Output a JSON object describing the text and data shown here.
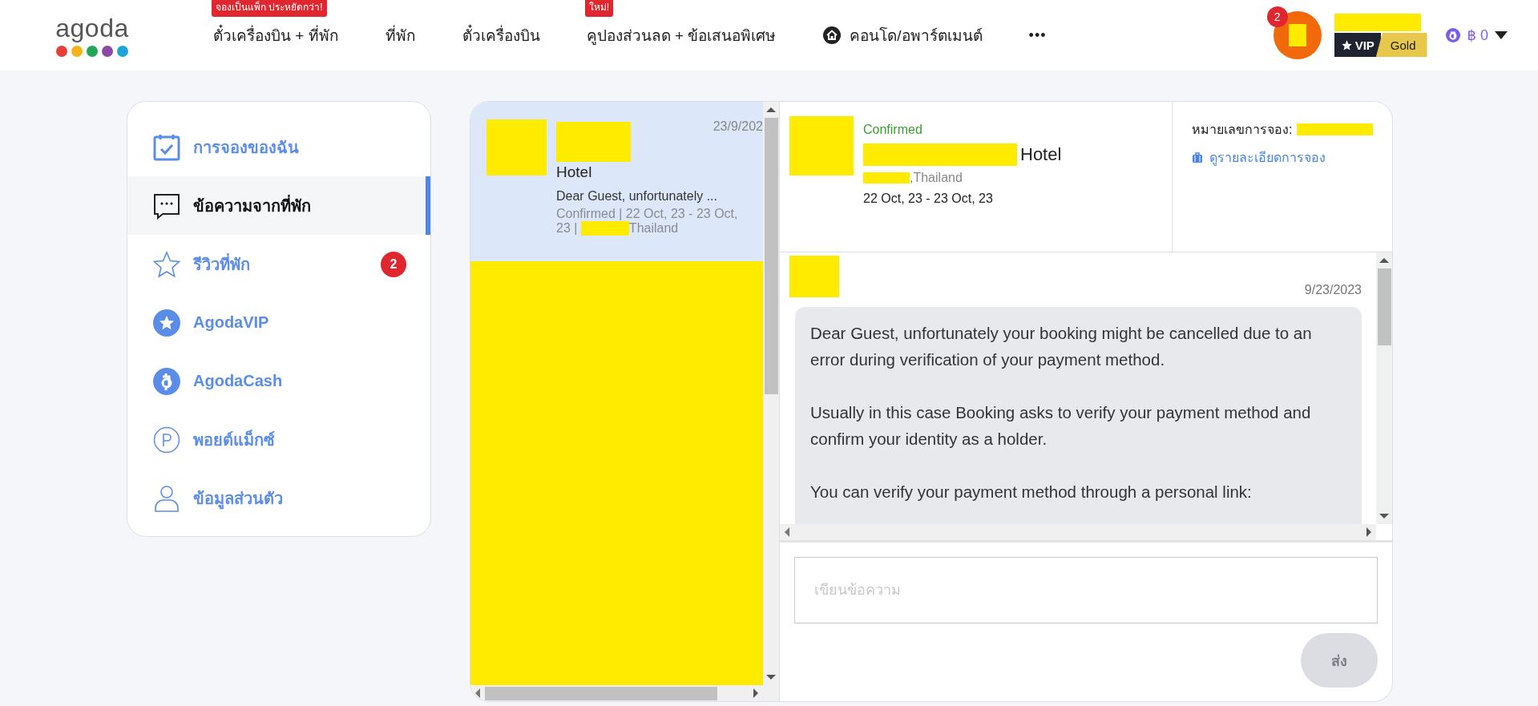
{
  "header": {
    "logo": "agoda",
    "nav": [
      {
        "label": "ตั๋วเครื่องบิน + ที่พัก",
        "badge": "จองเป็นแพ็ก ประหยัดกว่า!"
      },
      {
        "label": "ที่พัก"
      },
      {
        "label": "ตั๋วเครื่องบิน"
      },
      {
        "label": "คูปองส่วนลด + ข้อเสนอพิเศษ",
        "badge": "ใหม่!"
      },
      {
        "label": "คอนโด/อพาร์ตเมนต์",
        "kind": "home"
      }
    ],
    "more": "•••",
    "notifications": "2",
    "vip": "VIP",
    "tier": "Gold",
    "balance": "฿ 0"
  },
  "sidebar": {
    "items": [
      {
        "label": "การจองของฉัน",
        "kind": "calendar",
        "selected": false
      },
      {
        "label": "ข้อความจากที่พัก",
        "kind": "chat",
        "selected": true
      },
      {
        "label": "รีวิวที่พัก",
        "kind": "star",
        "selected": false,
        "badge": "2"
      },
      {
        "label": "AgodaVIP",
        "kind": "vip",
        "selected": false
      },
      {
        "label": "AgodaCash",
        "kind": "cash",
        "selected": false
      },
      {
        "label": "พอยต์แม็กซ์",
        "kind": "points",
        "selected": false
      },
      {
        "label": "ข้อมูลส่วนตัว",
        "kind": "person",
        "selected": false
      }
    ]
  },
  "conversations": [
    {
      "date": "23/9/202",
      "title": "Hotel",
      "preview": "Dear Guest, unfortunately ...",
      "meta": "Confirmed | 22 Oct, 23 - 23 Oct, 23 |",
      "location": "Thailand",
      "selected": true
    }
  ],
  "booking": {
    "status": "Confirmed",
    "hotel": "Hotel",
    "location": ",Thailand",
    "dates": "22 Oct, 23 - 23 Oct, 23",
    "number_label": "หมายเลขการจอง:",
    "details_link": "ดูรายละเอียดการจอง"
  },
  "message": {
    "date": "9/23/2023",
    "paragraphs": [
      "Dear Guest, unfortunately your booking might be cancelled due to an error during verification of your payment method.",
      "Usually in this case Booking asks to verify your payment method and confirm your identity as a holder.",
      "You can verify your payment method through a personal link:"
    ]
  },
  "compose": {
    "placeholder": "เขียนข้อความ",
    "send": "ส่ง",
    "send_disabled": true
  }
}
